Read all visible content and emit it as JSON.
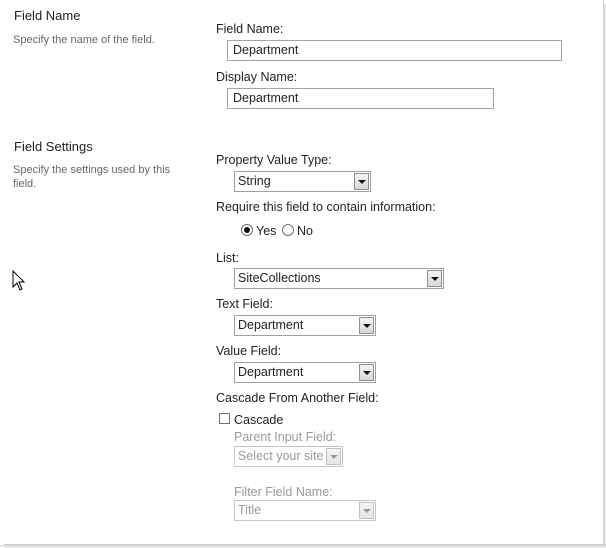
{
  "sections": {
    "field_name": {
      "title": "Field Name",
      "description": "Specify the name of the field."
    },
    "field_settings": {
      "title": "Field Settings",
      "description": "Specify the settings used by this field."
    }
  },
  "form": {
    "field_name_label": "Field Name:",
    "field_name_value": "Department",
    "display_name_label": "Display Name:",
    "display_name_value": "Department",
    "property_value_type_label": "Property Value Type:",
    "property_value_type_selected": "String",
    "require_label": "Require this field to contain information:",
    "require_options": [
      {
        "label": "Yes",
        "checked": true
      },
      {
        "label": "No",
        "checked": false
      }
    ],
    "list_label": "List:",
    "list_selected": "SiteCollections",
    "text_field_label": "Text Field:",
    "text_field_selected": "Department",
    "value_field_label": "Value Field:",
    "value_field_selected": "Department",
    "cascade_section_label": "Cascade From Another Field:",
    "cascade_checkbox_label": "Cascade",
    "cascade_checked": false,
    "parent_input_label": "Parent Input Field:",
    "parent_input_selected": "Select your site",
    "filter_field_label": "Filter Field Name:",
    "filter_field_selected": "Title"
  },
  "icons": {
    "cursor": "mouse-pointer-icon",
    "dropdown": "chevron-down-icon"
  }
}
